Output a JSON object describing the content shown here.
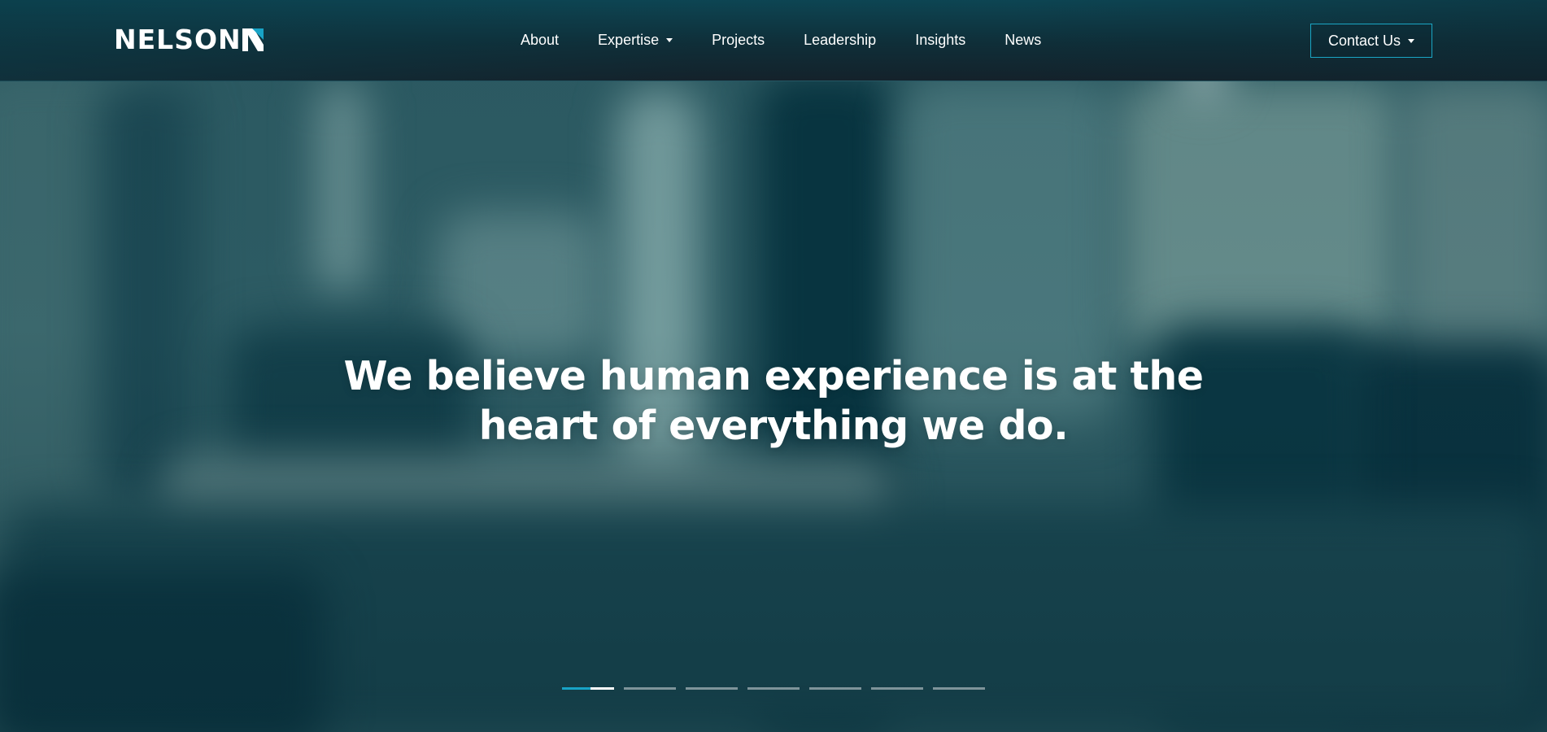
{
  "header": {
    "logo_text": "NELSON",
    "nav": [
      {
        "label": "About",
        "has_dropdown": false
      },
      {
        "label": "Expertise",
        "has_dropdown": true
      },
      {
        "label": "Projects",
        "has_dropdown": false
      },
      {
        "label": "Leadership",
        "has_dropdown": false
      },
      {
        "label": "Insights",
        "has_dropdown": false
      },
      {
        "label": "News",
        "has_dropdown": false
      }
    ],
    "contact_label": "Contact Us",
    "contact_has_dropdown": true
  },
  "hero": {
    "headline": "We believe human experience is at the heart of everything we do."
  },
  "slider": {
    "slide_count": 7,
    "active_index": 0,
    "active_progress": 0.55
  },
  "colors": {
    "accent": "#18a3c6",
    "header_bg": "#12232c",
    "hero_tint": "#2f5e66",
    "text": "#ffffff"
  },
  "icons": [
    "logo-mark-icon",
    "chevron-down-icon"
  ]
}
